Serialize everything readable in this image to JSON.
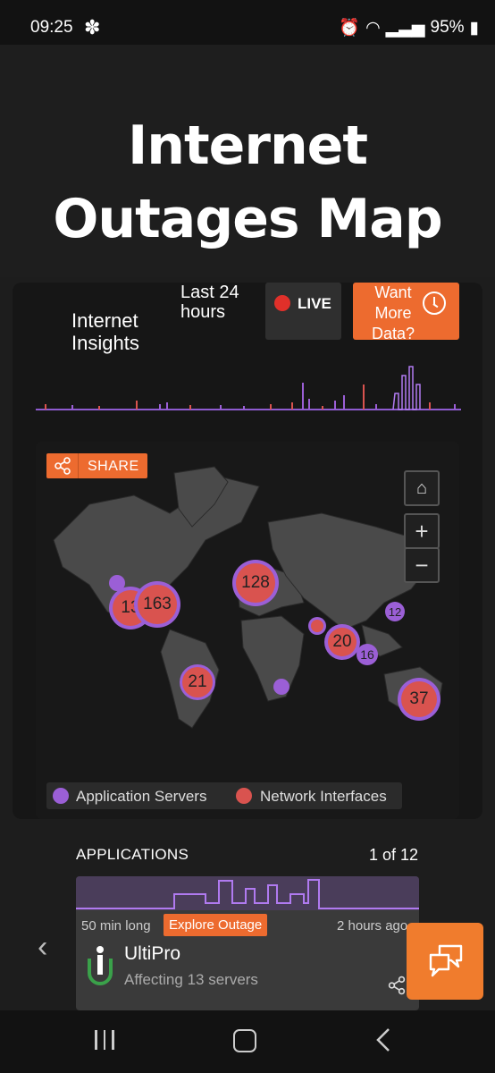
{
  "status_bar": {
    "time": "09:25",
    "battery": "95%"
  },
  "hero": {
    "title_line1": "Internet",
    "title_line2": "Outages Map"
  },
  "insights": {
    "title": "Internet Insights",
    "range": "Last 24 hours",
    "live_label": "LIVE",
    "more_data_label": "Want More Data?"
  },
  "map": {
    "share_label": "SHARE",
    "clusters": [
      {
        "count": "13",
        "type": "network"
      },
      {
        "count": "163",
        "type": "network"
      },
      {
        "count": "128",
        "type": "network"
      },
      {
        "count": "20",
        "type": "network"
      },
      {
        "count": "16",
        "type": "application"
      },
      {
        "count": "12",
        "type": "application"
      },
      {
        "count": "21",
        "type": "network"
      },
      {
        "count": "37",
        "type": "network"
      }
    ],
    "legend": [
      {
        "label": "Application Servers",
        "color": "#9b5fd6"
      },
      {
        "label": "Network Interfaces",
        "color": "#d9534f"
      }
    ]
  },
  "applications": {
    "heading": "APPLICATIONS",
    "pager": "1 of 12",
    "card": {
      "duration": "50 min long",
      "explore_label": "Explore Outage",
      "ago": "2 hours ago",
      "name": "UltiPro",
      "affecting": "Affecting 13 servers"
    }
  },
  "colors": {
    "accent": "#ed6b2f",
    "app_server": "#9b5fd6",
    "network_iface": "#d9534f"
  }
}
